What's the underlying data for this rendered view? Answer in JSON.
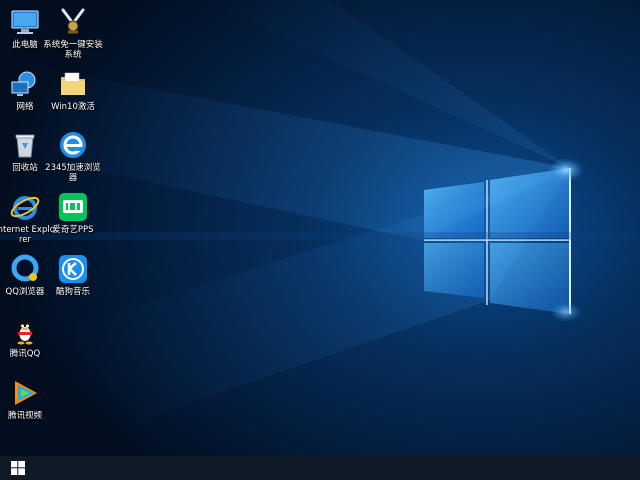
{
  "desktop": {
    "icons": [
      {
        "id": "this-pc",
        "label": "此电脑"
      },
      {
        "id": "system-installer",
        "label": "系统免一键安装系统"
      },
      {
        "id": "network",
        "label": "网络"
      },
      {
        "id": "win10-activate",
        "label": "Win10激活"
      },
      {
        "id": "recycle-bin",
        "label": "回收站"
      },
      {
        "id": "browser-2345",
        "label": "2345加速浏览器"
      },
      {
        "id": "internet-explorer",
        "label": "Internet Explorer"
      },
      {
        "id": "iqiyi-pps",
        "label": "爱奇艺PPS"
      },
      {
        "id": "qq-browser",
        "label": "QQ浏览器"
      },
      {
        "id": "kugou-music",
        "label": "酷狗音乐"
      },
      {
        "id": "tencent-qq",
        "label": "腾讯QQ"
      },
      {
        "id": "tencent-video",
        "label": "腾讯视频"
      }
    ]
  },
  "taskbar": {
    "start_icon": "windows-logo-icon"
  },
  "colors": {
    "wallpaper_dark": "#02142e",
    "wallpaper_glow": "#3aa0ff",
    "taskbar": "#101a26"
  }
}
